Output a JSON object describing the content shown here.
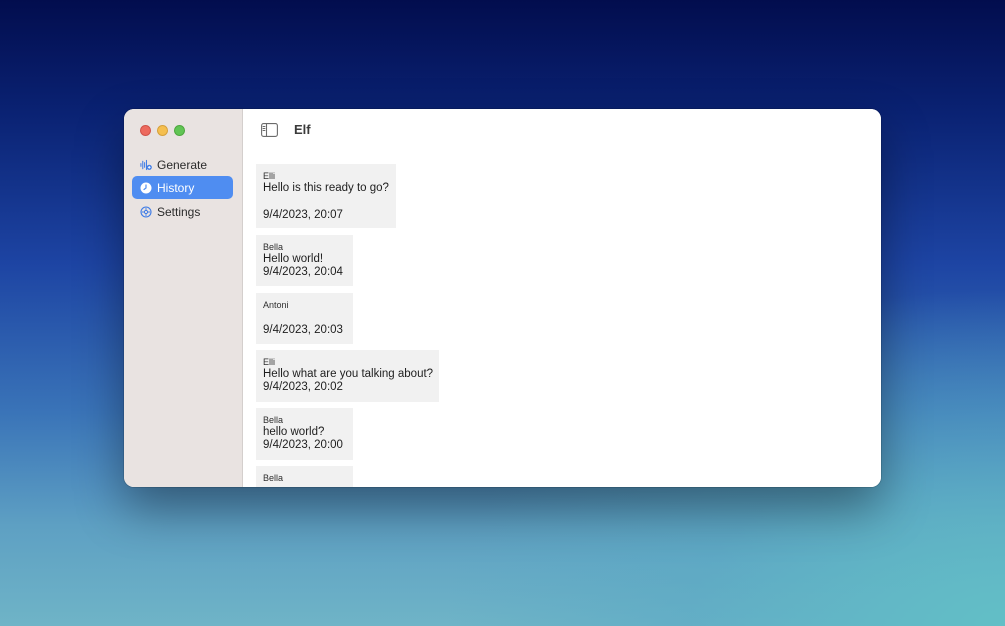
{
  "window": {
    "title": "Elf"
  },
  "sidebar": {
    "items": [
      {
        "label": "Generate",
        "icon": "waveform-plus-icon",
        "active": false
      },
      {
        "label": "History",
        "icon": "clock-icon",
        "active": true
      },
      {
        "label": "Settings",
        "icon": "gear-icon",
        "active": false
      }
    ]
  },
  "colors": {
    "accent": "#4f8df1",
    "sidebar_bg": "#e9e3e1",
    "entry_bg": "#f1f1f1",
    "traffic_close": "#ed6a5e",
    "traffic_minimize": "#f5bf4f",
    "traffic_maximize": "#61c554"
  },
  "history": [
    {
      "speaker": "Elli",
      "text": "Hello is this ready to go?",
      "timestamp": "9/4/2023, 20:07"
    },
    {
      "speaker": "Bella",
      "text": "Hello world!",
      "timestamp": "9/4/2023, 20:04"
    },
    {
      "speaker": "Antoni",
      "text": "",
      "timestamp": "9/4/2023, 20:03"
    },
    {
      "speaker": "Elli",
      "text": "Hello what are you talking about?",
      "timestamp": "9/4/2023, 20:02"
    },
    {
      "speaker": "Bella",
      "text": "hello world?",
      "timestamp": "9/4/2023, 20:00"
    },
    {
      "speaker": "Bella",
      "text": "",
      "timestamp": ""
    }
  ]
}
